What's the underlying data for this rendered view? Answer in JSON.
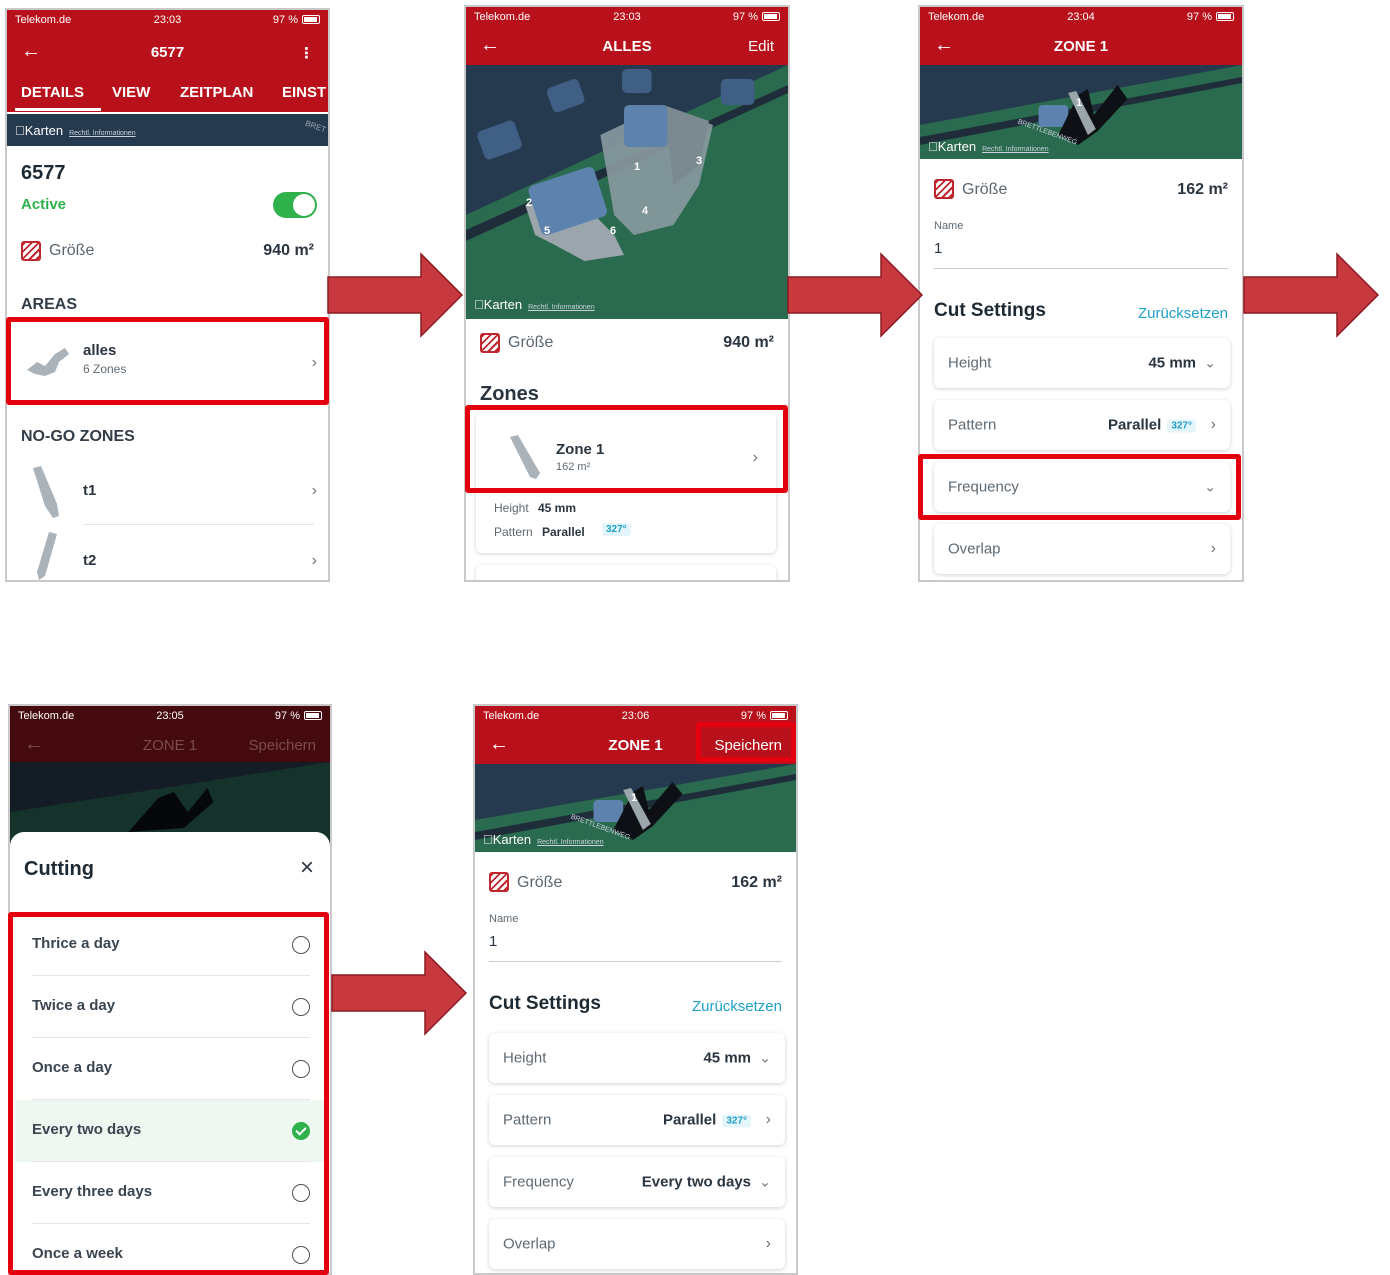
{
  "colors": {
    "brand_red": "#b9111b",
    "highlight_red": "#e5000f",
    "arrow_red": "#c8383f",
    "active_green": "#2fb14b",
    "link_blue": "#1fa0c9"
  },
  "screen1": {
    "status": {
      "carrier": "Telekom.de",
      "time": "23:03",
      "battery": "97 %"
    },
    "nav": {
      "title": "6577"
    },
    "tabs": [
      "DETAILS",
      "VIEW",
      "ZEITPLAN",
      "EINST"
    ],
    "map_label": "Karten",
    "map_legal": "Rechtl. Informationen",
    "map_street": "BRET",
    "title": "6577",
    "status_text": "Active",
    "toggle_on": true,
    "size_label": "Größe",
    "size_value": "940 m²",
    "areas_heading": "AREAS",
    "area": {
      "name": "alles",
      "sub": "6 Zones"
    },
    "nogo_heading": "NO-GO ZONES",
    "nogo": [
      {
        "name": "t1"
      },
      {
        "name": "t2"
      }
    ]
  },
  "screen2": {
    "status": {
      "carrier": "Telekom.de",
      "time": "23:03",
      "battery": "97 %"
    },
    "nav": {
      "title": "ALLES",
      "right": "Edit"
    },
    "map_label": "Karten",
    "map_legal": "Rechtl. Informationen",
    "zone_numbers": [
      "1",
      "2",
      "3",
      "4",
      "5",
      "6"
    ],
    "size_label": "Größe",
    "size_value": "940 m²",
    "zones_heading": "Zones",
    "zone": {
      "name": "Zone 1",
      "sub": "162 m²"
    },
    "height_label": "Height",
    "height_value": "45 mm",
    "pattern_label": "Pattern",
    "pattern_value": "Parallel",
    "pattern_deg": "327°"
  },
  "screen3": {
    "status": {
      "carrier": "Telekom.de",
      "time": "23:04",
      "battery": "97 %"
    },
    "nav": {
      "title": "ZONE 1"
    },
    "map_label": "Karten",
    "map_legal": "Rechtl. Informationen",
    "map_street": "BRETTLEBENWEG",
    "map_zone": "1",
    "size_label": "Größe",
    "size_value": "162 m²",
    "name_label": "Name",
    "name_value": "1",
    "cut_heading": "Cut Settings",
    "reset": "Zurücksetzen",
    "height_label": "Height",
    "height_value": "45 mm",
    "pattern_label": "Pattern",
    "pattern_value": "Parallel",
    "pattern_deg": "327°",
    "frequency_label": "Frequency",
    "overlap_label": "Overlap"
  },
  "screen4": {
    "status": {
      "carrier": "Telekom.de",
      "time": "23:05",
      "battery": "97 %"
    },
    "nav": {
      "title": "ZONE 1",
      "right": "Speichern"
    },
    "sheet_title": "Cutting",
    "options": [
      {
        "label": "Thrice a day",
        "checked": false
      },
      {
        "label": "Twice a day",
        "checked": false
      },
      {
        "label": "Once a day",
        "checked": false
      },
      {
        "label": "Every two days",
        "checked": true
      },
      {
        "label": "Every three days",
        "checked": false
      },
      {
        "label": "Once a week",
        "checked": false
      }
    ]
  },
  "screen5": {
    "status": {
      "carrier": "Telekom.de",
      "time": "23:06",
      "battery": "97 %"
    },
    "nav": {
      "title": "ZONE 1",
      "right": "Speichern"
    },
    "map_label": "Karten",
    "map_legal": "Rechtl. Informationen",
    "map_street": "BRETTLEBENWEG",
    "map_zone": "1",
    "size_label": "Größe",
    "size_value": "162 m²",
    "name_label": "Name",
    "name_value": "1",
    "cut_heading": "Cut Settings",
    "reset": "Zurücksetzen",
    "height_label": "Height",
    "height_value": "45 mm",
    "pattern_label": "Pattern",
    "pattern_value": "Parallel",
    "pattern_deg": "327°",
    "frequency_label": "Frequency",
    "frequency_value": "Every two days",
    "overlap_label": "Overlap"
  }
}
